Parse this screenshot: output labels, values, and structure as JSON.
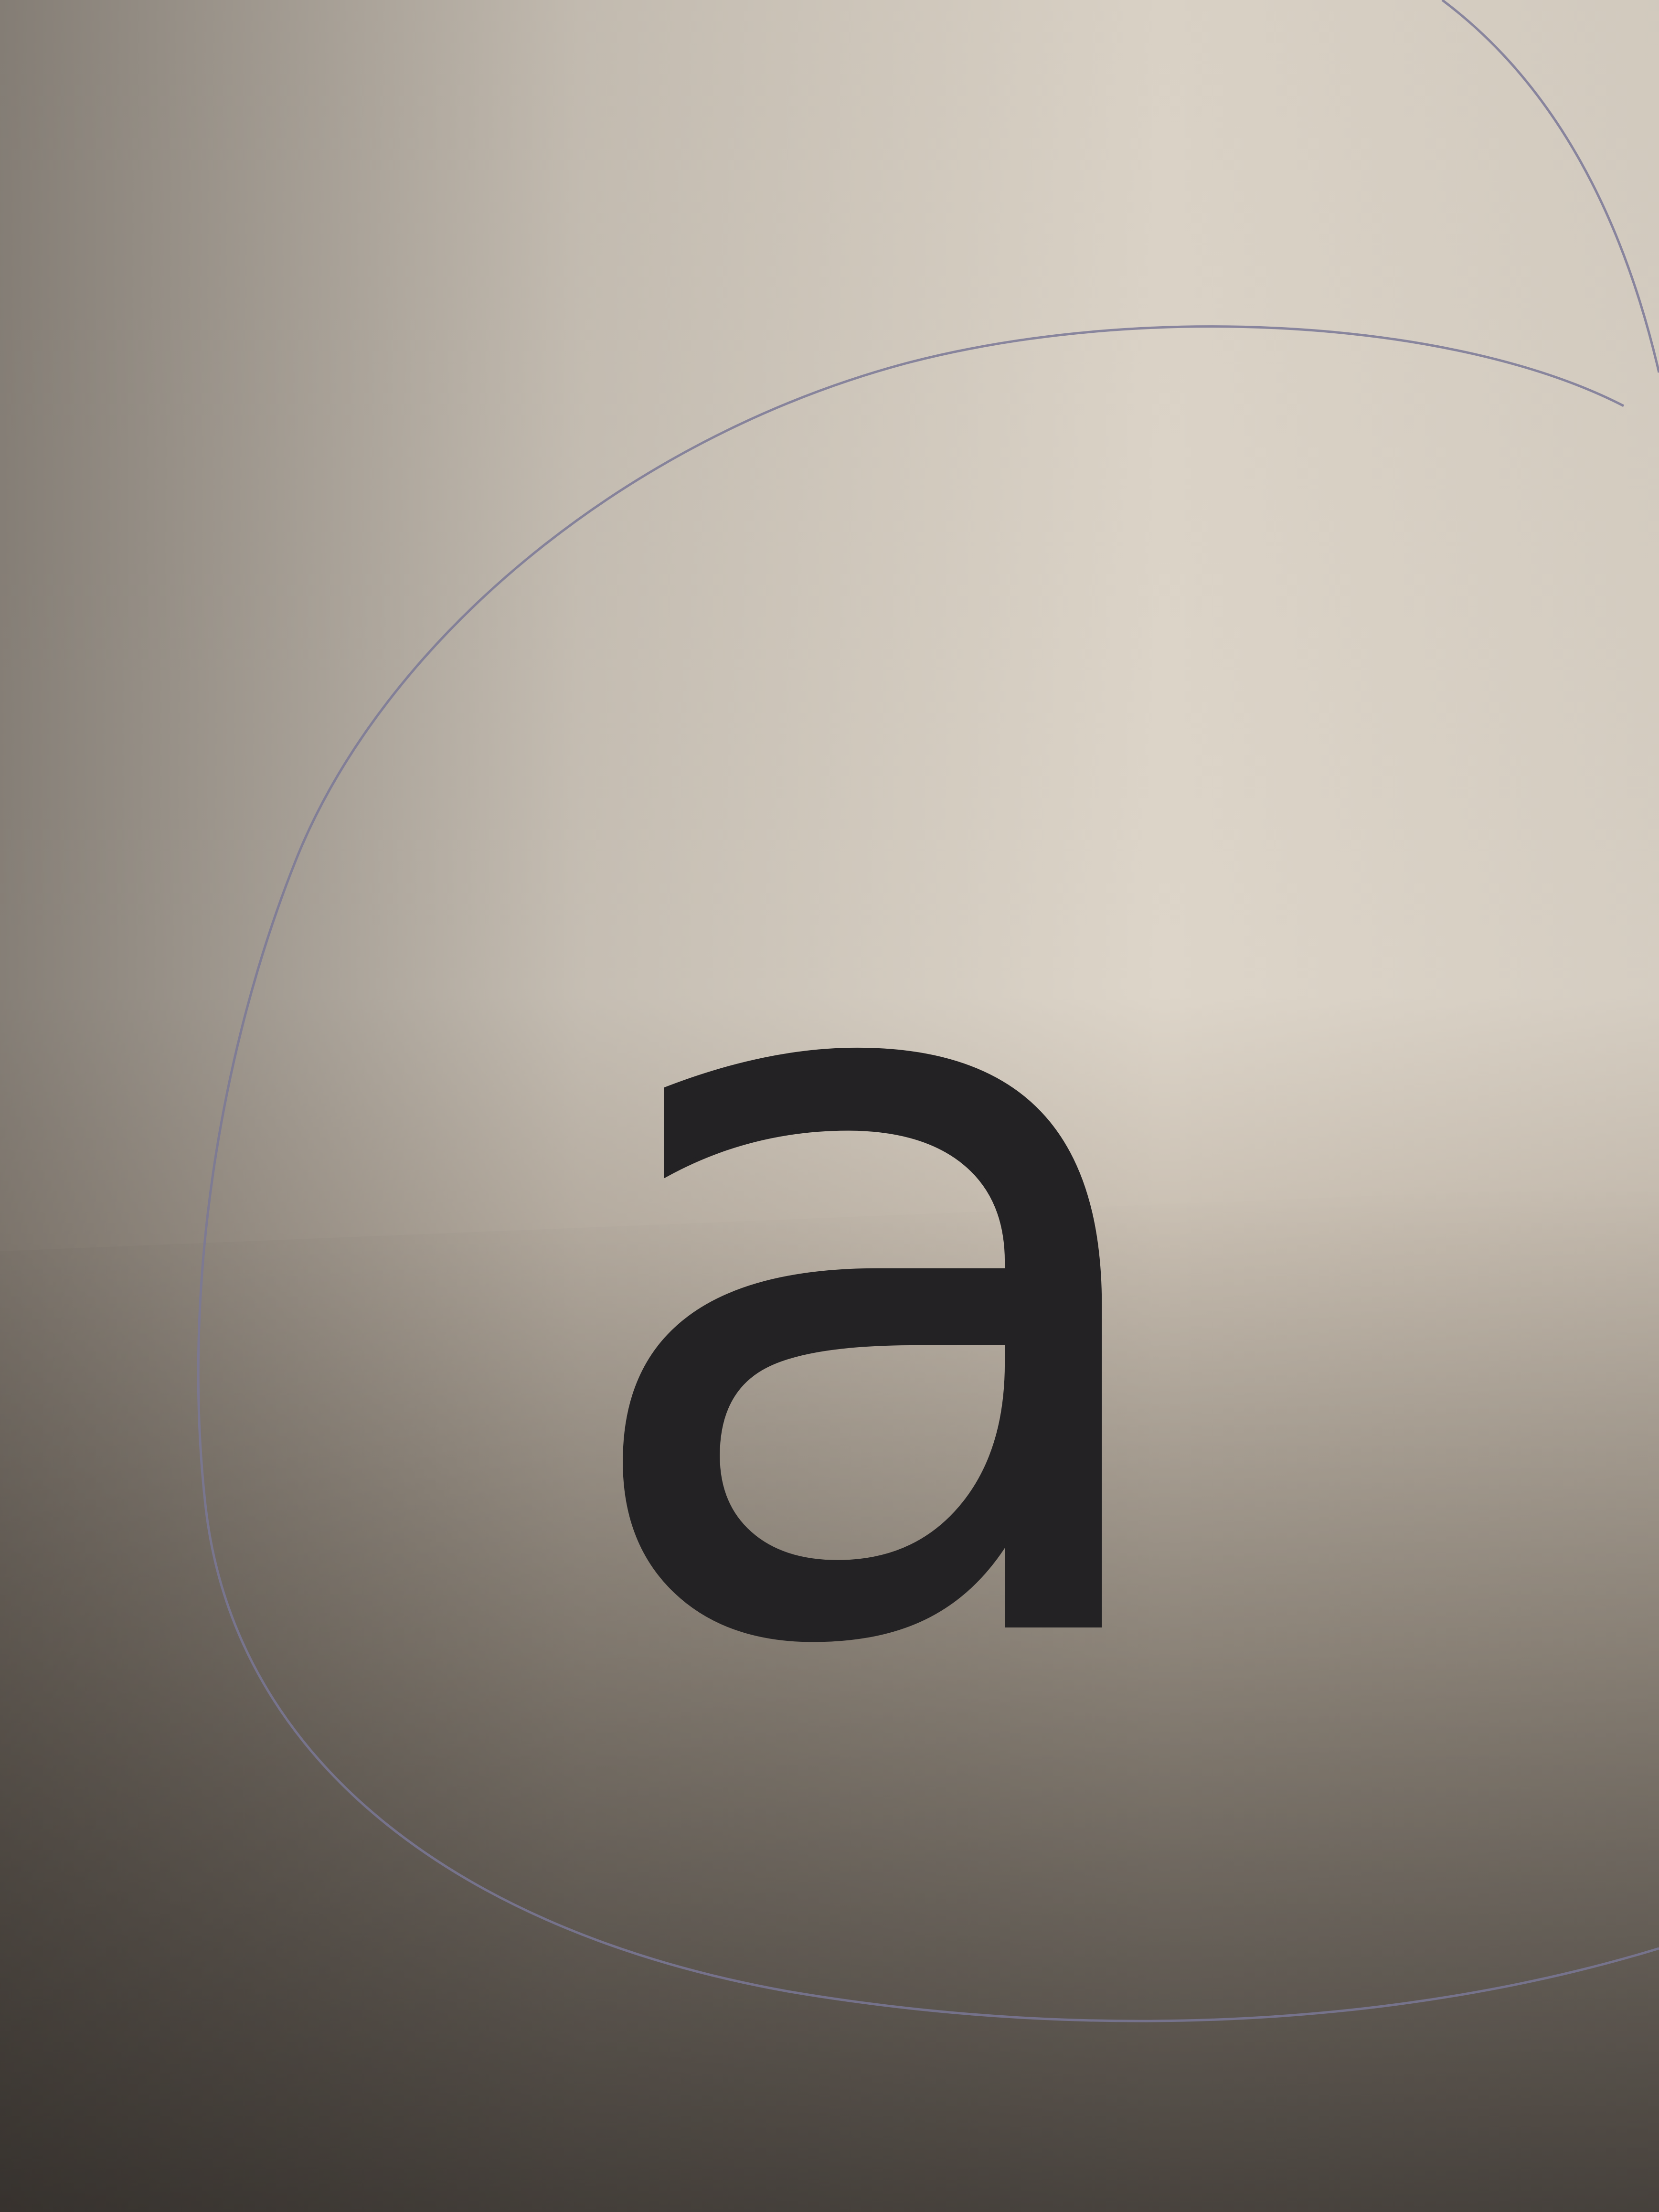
{
  "photo": {
    "letter": "a",
    "colors": {
      "paper": "#dcd4c8",
      "shadow": "#6f675f",
      "ink": "#232224",
      "pencil": "#7a7896"
    }
  }
}
